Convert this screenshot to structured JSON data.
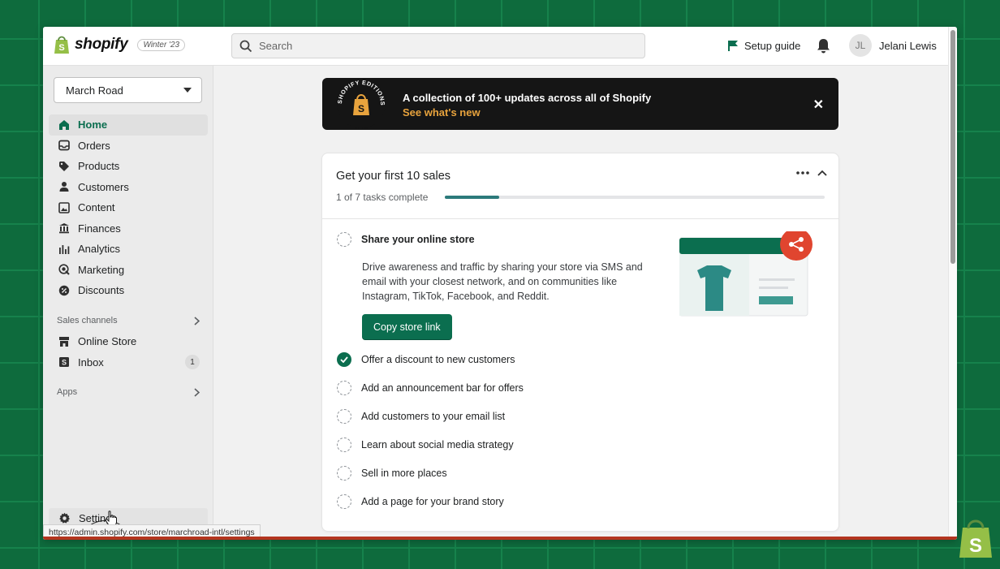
{
  "topbar": {
    "logo_text": "shopify",
    "logo_badge": "Winter '23",
    "search_placeholder": "Search",
    "setup_guide": "Setup guide",
    "user_initials": "JL",
    "user_name": "Jelani Lewis"
  },
  "sidebar": {
    "store_name": "March Road",
    "items": [
      {
        "label": "Home",
        "icon": "home-icon"
      },
      {
        "label": "Orders",
        "icon": "orders-icon"
      },
      {
        "label": "Products",
        "icon": "tag-icon"
      },
      {
        "label": "Customers",
        "icon": "person-icon"
      },
      {
        "label": "Content",
        "icon": "image-icon"
      },
      {
        "label": "Finances",
        "icon": "bank-icon"
      },
      {
        "label": "Analytics",
        "icon": "bar-chart-icon"
      },
      {
        "label": "Marketing",
        "icon": "target-icon"
      },
      {
        "label": "Discounts",
        "icon": "discount-icon"
      }
    ],
    "sales_channels": "Sales channels",
    "channels": [
      {
        "label": "Online Store",
        "icon": "store-icon"
      },
      {
        "label": "Inbox",
        "icon": "inbox-icon",
        "badge": "1"
      }
    ],
    "apps": "Apps",
    "settings": "Settings",
    "status_url": "https://admin.shopify.com/store/marchroad-intl/settings"
  },
  "banner": {
    "title": "A collection of 100+ updates across all of Shopify",
    "link": "See what's new",
    "badge_text": "SHOPIFY EDITIONS"
  },
  "card": {
    "title": "Get your first 10 sales",
    "progress_text": "1 of 7 tasks complete",
    "progress_fraction": 0.143,
    "tasks": [
      {
        "label": "Share your online store",
        "done": false,
        "expanded": true
      },
      {
        "label": "Offer a discount to new customers",
        "done": true
      },
      {
        "label": "Add an announcement bar for offers",
        "done": false
      },
      {
        "label": "Add customers to your email list",
        "done": false
      },
      {
        "label": "Learn about social media strategy",
        "done": false
      },
      {
        "label": "Sell in more places",
        "done": false
      },
      {
        "label": "Add a page for your brand story",
        "done": false
      }
    ],
    "expanded_description": "Drive awareness and traffic by sharing your store via SMS and email with your closest network, and on communities like Instagram, TikTok, Facebook, and Reddit.",
    "copy_button": "Copy store link"
  },
  "colors": {
    "accent": "#0b6e4f",
    "background": "#0e6b3d",
    "banner_link": "#e8a33d",
    "share_red": "#e0452f"
  }
}
